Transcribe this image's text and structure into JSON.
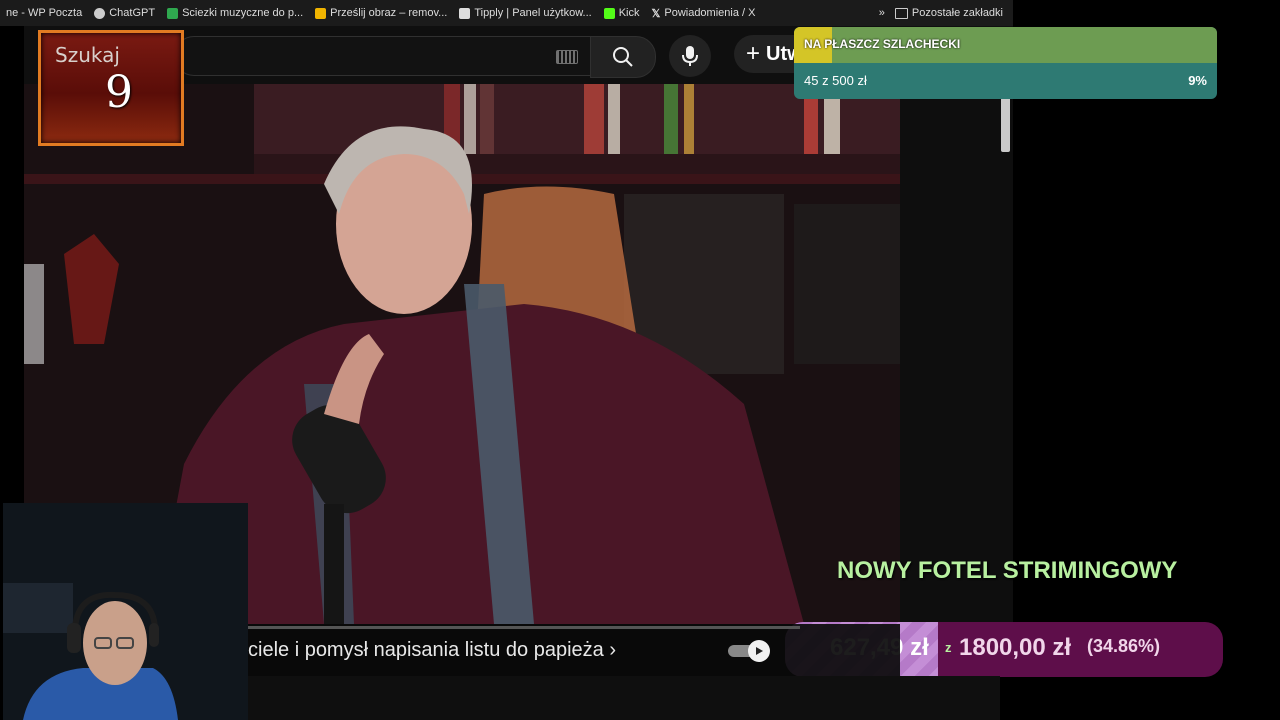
{
  "bookmarks": {
    "items": [
      {
        "label": "ne - WP Poczta",
        "color": "#e03030"
      },
      {
        "label": "ChatGPT",
        "color": "#cccccc"
      },
      {
        "label": "Sciezki muzyczne do p...",
        "color": "#2fa84f"
      },
      {
        "label": "Prześlij obraz – remov...",
        "color": "#f0b400"
      },
      {
        "label": "Tipply | Panel użytkow...",
        "color": "#dddddd"
      },
      {
        "label": "Kick",
        "color": "#53fc18"
      },
      {
        "label": "Powiadomienia / X",
        "color": "#ffffff"
      }
    ],
    "more_icon": "double-chevron-icon",
    "other_bookmarks": "Pozostałe zakładki"
  },
  "youtube": {
    "create_label": "Utw",
    "search_icon": "search-icon",
    "mic_icon": "microphone-icon"
  },
  "search_counter": {
    "label": "Szukaj",
    "value": "9"
  },
  "goal": {
    "title": "NA PŁASZCZ SZLACHECKI",
    "amount": "45 z 500 zł",
    "percent": "9%",
    "progress": 0.09,
    "colors": {
      "fill": "#d4c527",
      "top": "#6d9c52",
      "bottom": "#2e7a73"
    }
  },
  "fundraiser": {
    "title": "NOWY FOTEL STRIMINGOWY",
    "current": "627,49 zł",
    "separator": "z",
    "target": "1800,00 zł",
    "percent": "(34.86%)",
    "progress": 0.3486,
    "colors": {
      "fill": "#c48ed6",
      "bar": "#5e0e4a",
      "title": "#b8f0a0"
    }
  },
  "video": {
    "title": "ciele i pomysł napisania listu do papieża ›",
    "autoplay_icon": "play-icon"
  }
}
